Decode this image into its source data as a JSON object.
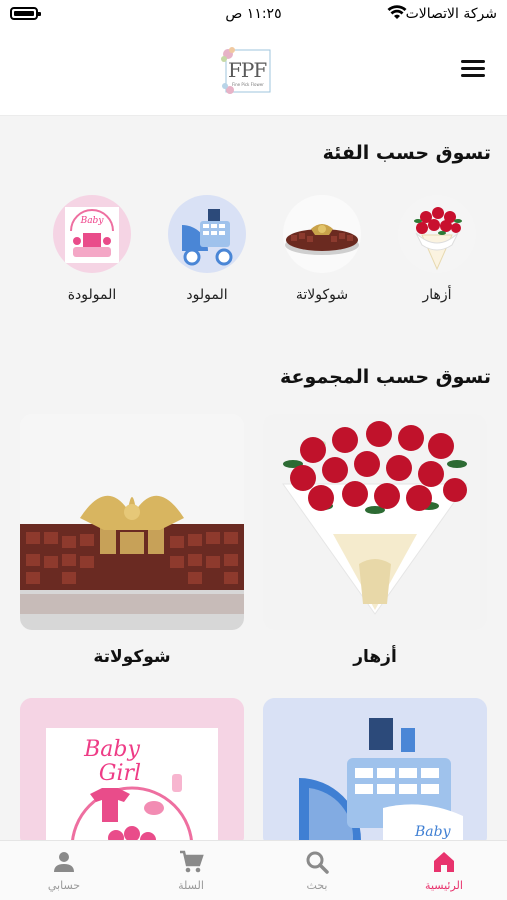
{
  "status_bar": {
    "carrier": "شركة الاتصالات",
    "time": "١١:٢٥ ص"
  },
  "header": {
    "logo_text": "FPF",
    "logo_subtext": "Fine Pick Flower"
  },
  "categories_section": {
    "title": "تسوق حسب الفئة",
    "items": [
      {
        "label": "أزهار",
        "icon": "flowers-bouquet-image"
      },
      {
        "label": "شوكولاتة",
        "icon": "chocolate-tray-image"
      },
      {
        "label": "المولود",
        "icon": "baby-boy-stroller-image"
      },
      {
        "label": "المولودة",
        "icon": "baby-girl-gift-image"
      }
    ]
  },
  "collections_section": {
    "title": "تسوق حسب المجموعة",
    "items": [
      {
        "label": "أزهار",
        "image": "red-roses-bouquet"
      },
      {
        "label": "شوكولاتة",
        "image": "chocolate-tray"
      },
      {
        "label": "",
        "image": "baby-boy-stroller-arrangement"
      },
      {
        "label": "",
        "image": "baby-girl-arrangement"
      }
    ]
  },
  "tab_bar": {
    "items": [
      {
        "label": "الرئيسية",
        "icon": "home-icon",
        "active": true
      },
      {
        "label": "بحث",
        "icon": "search-icon",
        "active": false
      },
      {
        "label": "السلة",
        "icon": "cart-icon",
        "active": false
      },
      {
        "label": "حسابي",
        "icon": "account-icon",
        "active": false
      }
    ],
    "active_color": "#e8336d",
    "inactive_color": "#999999"
  },
  "colors": {
    "accent": "#e8336d",
    "background": "#f4f4f4"
  }
}
